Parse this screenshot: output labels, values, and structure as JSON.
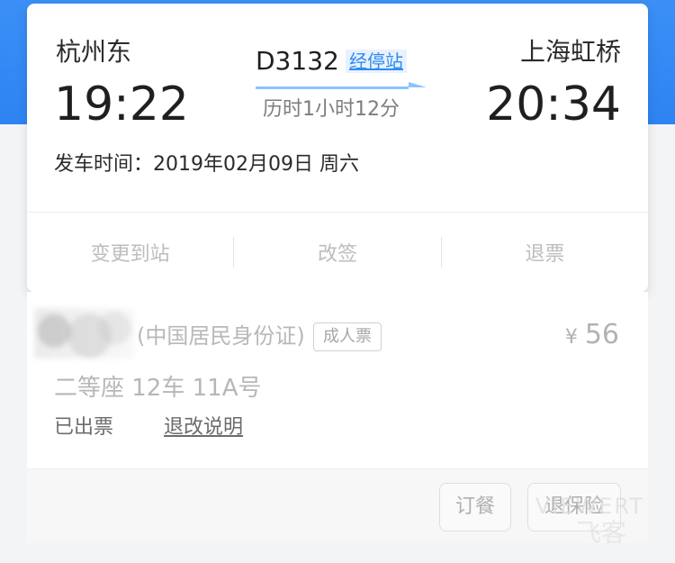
{
  "header": {
    "depart_station": "杭州东",
    "arrive_station": "上海虹桥",
    "depart_time": "19:22",
    "arrive_time": "20:34",
    "train_no": "D3132",
    "via_label": "经停站",
    "duration": "历时1小时12分",
    "depart_date": "发车时间：2019年02月09日 周六"
  },
  "actions": [
    "变更到站",
    "改签",
    "退票"
  ],
  "passenger": {
    "name_visible": "",
    "id_type": "(中国居民身份证)",
    "ticket_kind": "成人票",
    "price_symbol": "¥",
    "price": "56",
    "seat": "二等座 12车 11A号",
    "status": "已出票",
    "rules_link": "退改说明"
  },
  "footer": {
    "meal_button": "订餐",
    "insurance_button": "退保险"
  },
  "watermark": {
    "top": "VIEWERT",
    "bottom": "飞客"
  },
  "colors": {
    "brand_blue": "#2d84f2",
    "link_blue": "#2e8cf0",
    "text_dark": "#1f1f1f",
    "text_muted": "#b0b0b0"
  },
  "icons": {
    "arrow": "right-arrow-icon",
    "blur": "blurred-name-icon"
  }
}
